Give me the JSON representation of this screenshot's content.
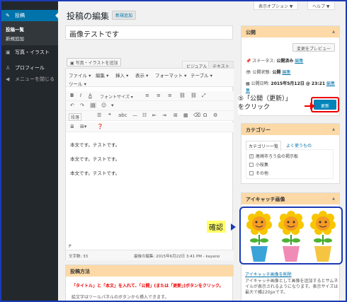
{
  "sidebar": {
    "items": [
      {
        "label": "投稿",
        "icon": "pin-icon"
      },
      {
        "label": "写真・イラスト",
        "icon": "media-icon"
      },
      {
        "label": "プロフィール",
        "icon": "user-icon"
      },
      {
        "label": "メニューを閉じる",
        "icon": "collapse-icon"
      }
    ],
    "submenu": [
      "投稿一覧",
      "新規追加"
    ]
  },
  "header": {
    "title": "投稿の編集",
    "add_new": "新規追加",
    "screen_options": "表示オプション ▼",
    "help": "ヘルプ ▼"
  },
  "post": {
    "title_value": "画像テストです",
    "media_button": "写真・イラストを追加",
    "tab_visual": "ビジュアル",
    "tab_text": "テキスト"
  },
  "editor": {
    "menu": [
      "ファイル ▾",
      "編集 ▾",
      "挿入 ▾",
      "表示 ▾",
      "フォーマット ▾",
      "テーブル ▾",
      "ツール ▾"
    ],
    "font_size": "フォントサイズ ▾",
    "paragraph": "段落",
    "paragraphs": [
      "本文です。テストです。",
      "本文です。テストです。",
      "本文です。テストです。"
    ],
    "path": "P",
    "word_count": "文字数: 33",
    "last_edited": "最後の編集: 2015年6月22日 3:41 PM - kayano"
  },
  "howto": {
    "title": "投稿方法",
    "instruction": "「タイトル」と「本文」を入れて、「公開」(または「更新」)ボタンをクリック。",
    "note": "絵文字はツールパネルのボタンから挿入できます。"
  },
  "publish": {
    "title": "公開",
    "preview_button": "変更をプレビュー",
    "status_label": "ステータス:",
    "status_value": "公開済み",
    "visibility_label": "公開状態:",
    "visibility_value": "公開",
    "date_label": "公開日時:",
    "date_value": "2015年5月12日 @ 23:21",
    "edit_link": "編集",
    "edit_link_2": "編集",
    "edit_link_3": "編集",
    "edit_link_3b": "集",
    "update_button": "更新"
  },
  "annotation": {
    "callout_line1": "⑤「公開（更新）」",
    "callout_line2": "をクリック",
    "confirm": "確認"
  },
  "category": {
    "title": "カテゴリー",
    "tab_all": "カテゴリー一覧",
    "tab_popular": "よく使うもの",
    "items": [
      {
        "label": "尾崎市ろう会の掲示板",
        "checked": true
      },
      {
        "label": "小枝集",
        "checked": false
      },
      {
        "label": "その他",
        "checked": false
      }
    ]
  },
  "featured": {
    "title": "アイキャッチ画像",
    "link": "アイキャッチ画像を削除",
    "desc": "アイキャッチ画像として画像を追加するとサムネイルが表示されるようになります。表示サイズは最大で横220pxです。"
  },
  "colors": {
    "accent": "#0073aa",
    "box_header": "#fcd9a6",
    "annotation_red": "#e00000",
    "frame_blue": "#1b3bb5"
  }
}
